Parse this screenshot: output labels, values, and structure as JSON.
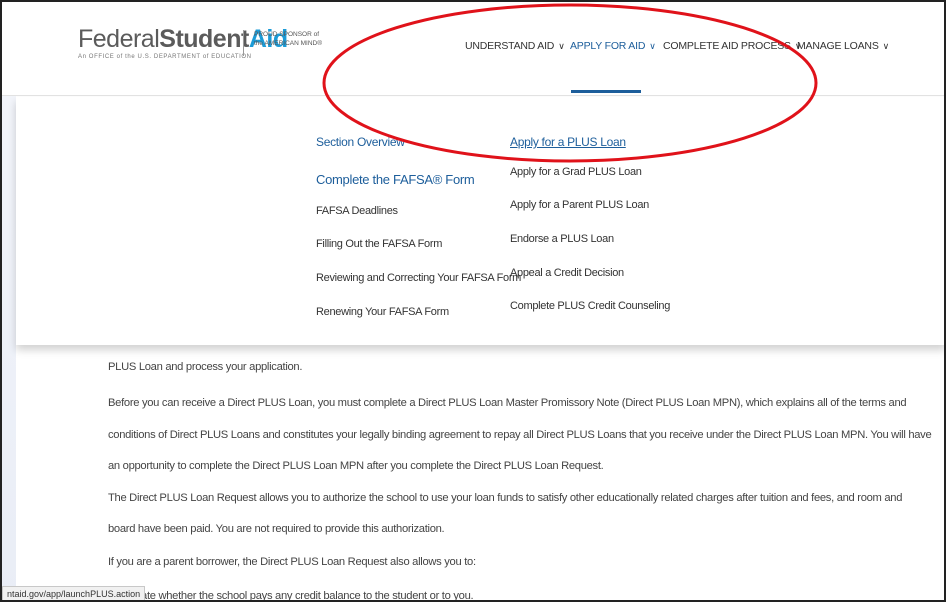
{
  "header": {
    "logo": {
      "word_federal": "Federal",
      "word_student": "Student",
      "word_aid": "Aid",
      "subline": "An OFFICE of the U.S. DEPARTMENT of EDUCATION"
    },
    "sponsor": {
      "line1": "PROUD SPONSOR of",
      "line2": "the AMERICAN MIND®"
    },
    "nav": [
      {
        "label": "UNDERSTAND AID"
      },
      {
        "label": "APPLY FOR AID"
      },
      {
        "label": "COMPLETE AID PROCESS"
      },
      {
        "label": "MANAGE LOANS"
      }
    ],
    "active_nav": "APPLY FOR AID"
  },
  "dropdown": {
    "left": [
      {
        "label": "Section Overview"
      },
      {
        "label": "Complete the FAFSA® Form"
      },
      {
        "label": "FAFSA Deadlines"
      },
      {
        "label": "Filling Out the FAFSA Form"
      },
      {
        "label": "Reviewing and Correcting Your FAFSA Form"
      },
      {
        "label": "Renewing Your FAFSA Form"
      }
    ],
    "right": [
      {
        "label": "Apply for a PLUS Loan"
      },
      {
        "label": "Apply for a Grad PLUS Loan"
      },
      {
        "label": "Apply for a Parent PLUS Loan"
      },
      {
        "label": "Endorse a PLUS Loan"
      },
      {
        "label": "Appeal a Credit Decision"
      },
      {
        "label": "Complete PLUS Credit Counseling"
      }
    ]
  },
  "content": {
    "lines": [
      "PLUS Loan and process your application.",
      "Before you can receive a Direct PLUS Loan, you must complete a Direct PLUS Loan Master Promissory Note (Direct PLUS Loan MPN), which explains all of the terms and",
      "conditions of Direct PLUS Loans and constitutes your legally binding agreement to repay all Direct PLUS Loans that you receive under the Direct PLUS Loan MPN. You will have",
      "an opportunity to complete the Direct PLUS Loan MPN after you complete the Direct PLUS Loan Request.",
      "The Direct PLUS Loan Request allows you to authorize the school to use your loan funds to satisfy other educationally related charges after tuition and fees, and room and",
      "board have been paid. You are not required to provide this authorization.",
      "If you are a parent borrower, the Direct PLUS Loan Request also allows you to:",
      "Designate whether the school pays any credit balance to the student or to you."
    ]
  },
  "status_bar": {
    "url": "ntaid.gov/app/launchPLUS.action"
  },
  "colors": {
    "brand_blue": "#1d5e9b",
    "aid_blue": "#1b9bd7",
    "annotation_red": "#e0121a"
  }
}
